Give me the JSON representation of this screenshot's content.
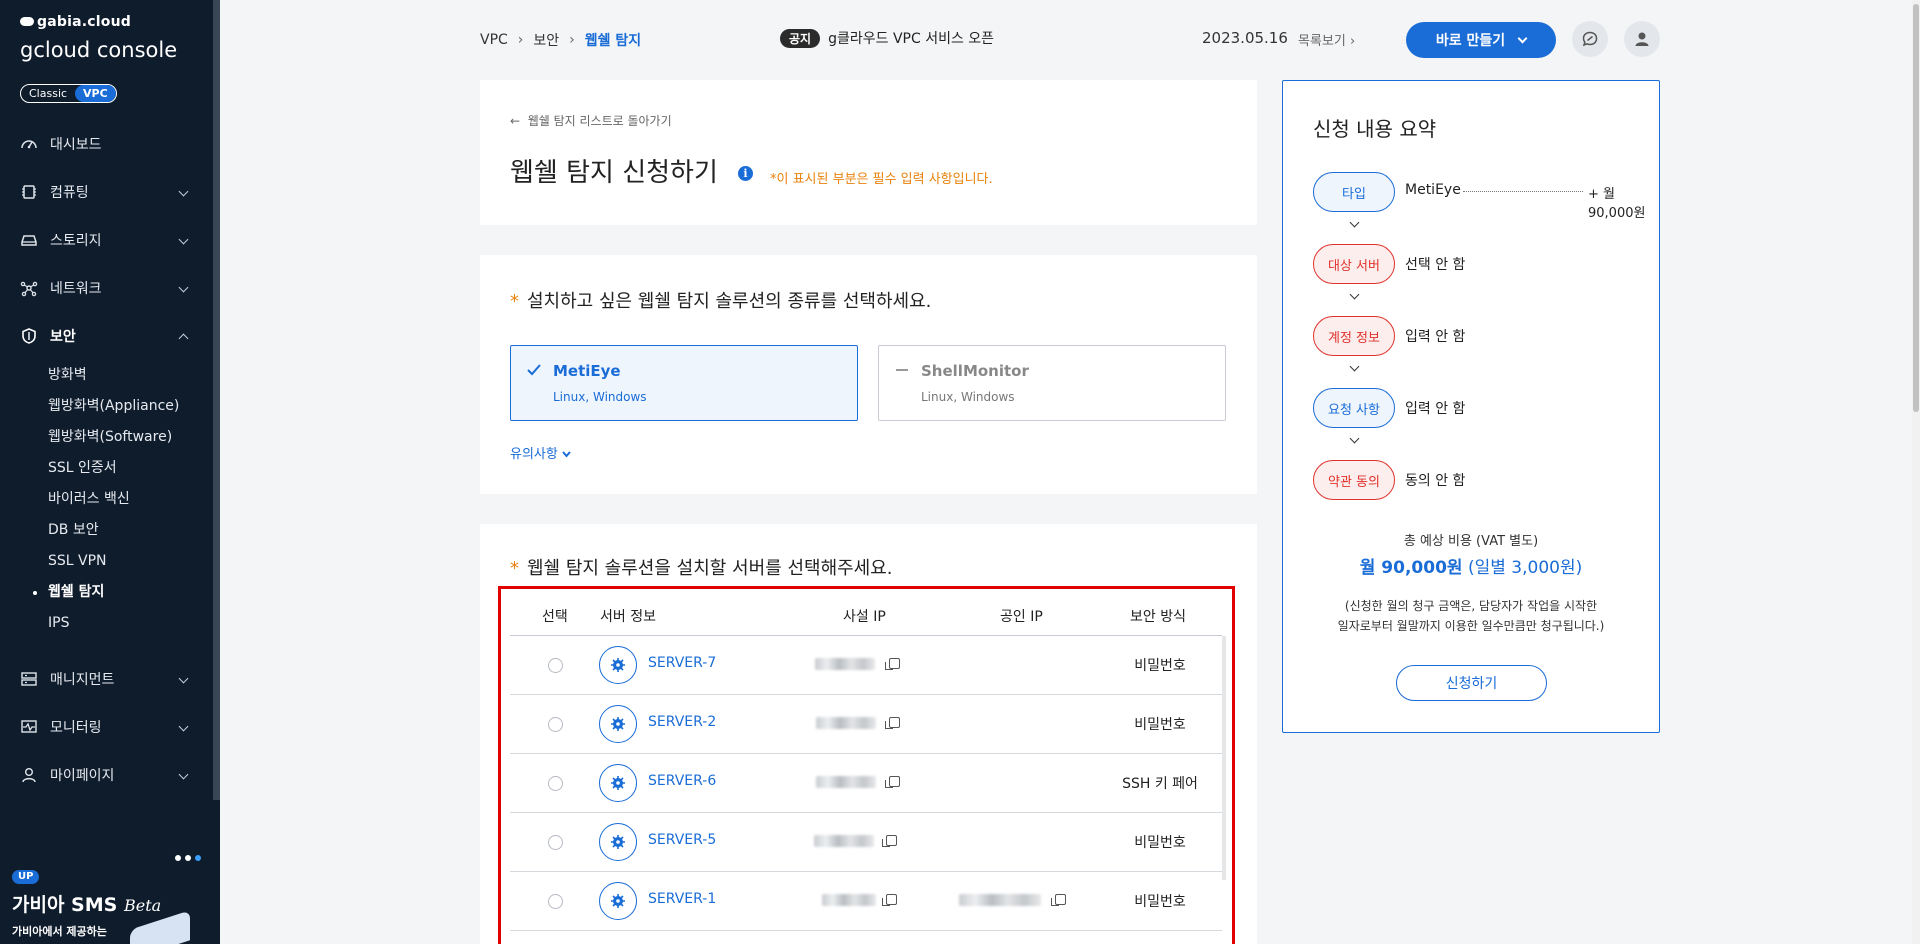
{
  "sidebar": {
    "brand_top": "gabia.cloud",
    "brand_main": "gcloud console",
    "toggle": {
      "classic": "Classic",
      "vpc": "VPC"
    },
    "items": [
      {
        "label": "대시보드",
        "icon": "dashboard-icon"
      },
      {
        "label": "컴퓨팅",
        "icon": "chip-icon"
      },
      {
        "label": "스토리지",
        "icon": "storage-icon"
      },
      {
        "label": "네트워크",
        "icon": "network-icon"
      },
      {
        "label": "보안",
        "icon": "shield-icon"
      },
      {
        "label": "매니지먼트",
        "icon": "management-icon"
      },
      {
        "label": "모니터링",
        "icon": "monitor-icon"
      },
      {
        "label": "마이페이지",
        "icon": "user-icon"
      }
    ],
    "security_sub": [
      "방화벽",
      "웹방화벽(Appliance)",
      "웹방화벽(Software)",
      "SSL 인증서",
      "바이러스 백신",
      "DB 보안",
      "SSL VPN",
      "웹쉘 탐지",
      "IPS"
    ],
    "promo": {
      "badge": "UP",
      "title": "가비아 SMS",
      "title_em": "Beta",
      "subtitle": "가비아에서 제공하는"
    }
  },
  "header": {
    "breadcrumb": [
      "VPC",
      "보안",
      "웹쉘 탐지"
    ],
    "notice_badge": "공지",
    "notice_text": "g클라우드 VPC 서비스 오픈",
    "date": "2023.05.16",
    "more": "목록보기",
    "create_button": "바로 만들기"
  },
  "intro": {
    "back_link": "웹쉘 탐지 리스트로 돌아가기",
    "title": "웹쉘 탐지 신청하기",
    "required_note": "*이 표시된 부분은 필수 입력 사항입니다."
  },
  "solution": {
    "question": "설치하고 싶은 웹쉘 탐지 솔루션의 종류를 선택하세요.",
    "options": [
      {
        "name": "MetiEye",
        "os": "Linux, Windows",
        "selected": true
      },
      {
        "name": "ShellMonitor",
        "os": "Linux, Windows",
        "selected": false
      }
    ],
    "caution": "유의사항"
  },
  "servers": {
    "question": "웹쉘 탐지 솔루션을 설치할 서버를 선택해주세요.",
    "columns": [
      "선택",
      "서버 정보",
      "사설 IP",
      "공인 IP",
      "보안 방식"
    ],
    "rows": [
      {
        "name": "SERVER-7",
        "security": "비밀번호",
        "has_public_ip": false
      },
      {
        "name": "SERVER-2",
        "security": "비밀번호",
        "has_public_ip": false
      },
      {
        "name": "SERVER-6",
        "security": "SSH 키 페어",
        "has_public_ip": false
      },
      {
        "name": "SERVER-5",
        "security": "비밀번호",
        "has_public_ip": false
      },
      {
        "name": "SERVER-1",
        "security": "비밀번호",
        "has_public_ip": true
      }
    ]
  },
  "summary": {
    "title": "신청 내용 요약",
    "steps": [
      {
        "label": "타입",
        "value": "MetiEye",
        "price": "+ 월 90,000원",
        "done": true
      },
      {
        "label": "대상 서버",
        "value": "선택 안 함",
        "done": false
      },
      {
        "label": "계정 정보",
        "value": "입력 안 함",
        "done": false
      },
      {
        "label": "요청 사항",
        "value": "입력 안 함",
        "done": true
      },
      {
        "label": "약관 동의",
        "value": "동의 안 함",
        "done": false
      }
    ],
    "total_label": "총 예상 비용 (VAT 별도)",
    "total_price": "월 90,000원",
    "total_daily": "(일별 3,000원)",
    "note_line1": "(신청한 월의 청구 금액은, 담당자가 작업을 시작한",
    "note_line2": "일자로부터 월말까지 이용한 일수만큼만 청구됩니다.)",
    "apply_button": "신청하기"
  },
  "colors": {
    "accent": "#1a6cd6",
    "warning": "#e8820c",
    "danger": "#e0322c",
    "sidebar_bg": "#0f1c2c",
    "highlight_box": "#e00000"
  }
}
